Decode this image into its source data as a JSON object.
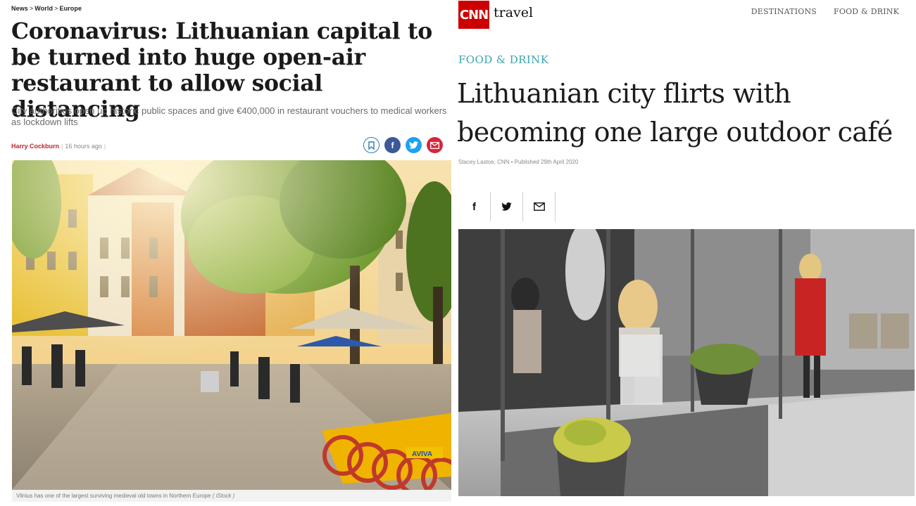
{
  "left": {
    "breadcrumb": [
      "News",
      "World",
      "Europe"
    ],
    "breadcrumb_sep": ">",
    "headline": "Coronavirus: Lithuanian capital to be turned into huge open-air restaurant to allow social distancing",
    "subheadline": "City authorities open up historic public spaces and give €400,000 in restaurant vouchers to medical workers as lockdown lifts",
    "author": "Harry Cockburn",
    "timestamp": "16 hours ago",
    "share_icons": [
      "bookmark-icon",
      "facebook-icon",
      "twitter-icon",
      "email-icon"
    ],
    "photo_caption": "Vilnius has one of the largest surviving medieval old towns in Northern Europe",
    "photo_credit": "( iStock )",
    "bike_brand": "AVIVA",
    "colors": {
      "author": "#c0272d",
      "facebook": "#3b5998",
      "twitter": "#1da1f2",
      "email": "#d7263d"
    }
  },
  "right": {
    "logo": "CNN",
    "section": "travel",
    "nav": [
      "DESTINATIONS",
      "FOOD & DRINK"
    ],
    "category": "FOOD & DRINK",
    "headline": "Lithuanian city flirts with becoming one large outdoor café",
    "byline": "Stacey Lastoe, CNN • Published 29th April 2020",
    "share_buttons": [
      "facebook-icon",
      "twitter-icon",
      "email-icon"
    ],
    "colors": {
      "logo": "#cc0000",
      "category": "#3aa6b0"
    }
  }
}
